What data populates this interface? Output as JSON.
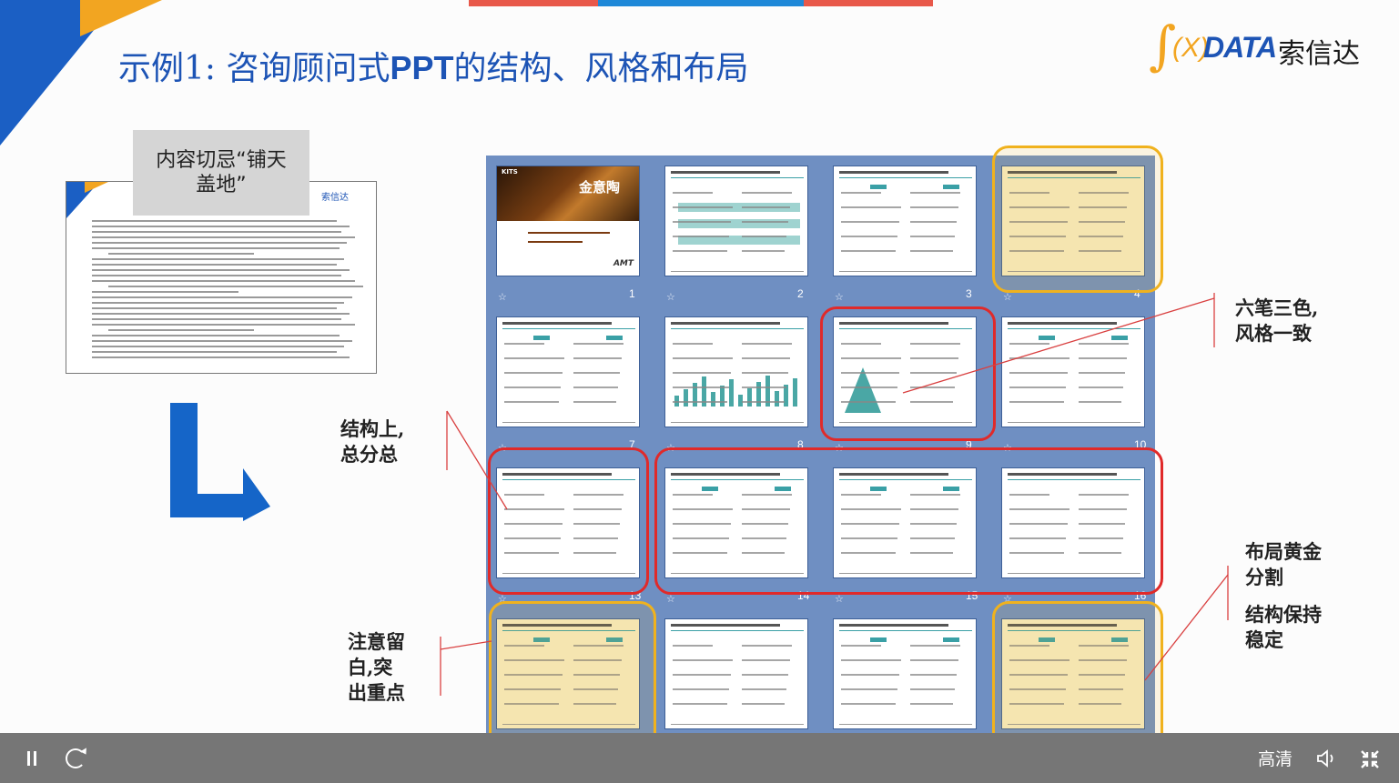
{
  "slide": {
    "title_prefix": "示例1:",
    "title_bold": "PPT",
    "title_part1": "咨询顾问式",
    "title_part2": "的结构、风格和布局",
    "logo_x": "(X)",
    "logo_data": "DATA",
    "logo_cn": "索信达",
    "doc_label_line1": "内容切忌“铺天",
    "doc_label_line2": "盖地”",
    "doc_logo_text": "索信达",
    "cover_kit": "KITS",
    "cover_title": "金意陶",
    "cover_amt": "AMT",
    "annotations": {
      "structure_l1": "结构上,",
      "structure_l2": "总分总",
      "whitespace_l1": "注意留",
      "whitespace_l2": "白,突",
      "whitespace_l3": "出重点",
      "style_l1": "六笔三色,",
      "style_l2": "风格一致",
      "layout_l1": "布局黄金",
      "layout_l2": "分割",
      "stable_l1": "结构保持",
      "stable_l2": "稳定"
    },
    "slide_numbers": [
      "1",
      "2",
      "3",
      "4",
      "7",
      "8",
      "9",
      "10",
      "13",
      "14",
      "15",
      "16"
    ]
  },
  "colors": {
    "accent_blue": "#1d54b5",
    "accent_orange": "#f2a521",
    "highlight_red": "#e02a2a",
    "highlight_gold": "#f0b21e",
    "panel_bg": "#6f8fc2"
  },
  "controls": {
    "quality_label": "高清",
    "icons": [
      "pause-icon",
      "replay-icon",
      "volume-icon",
      "exit-fullscreen-icon"
    ]
  }
}
